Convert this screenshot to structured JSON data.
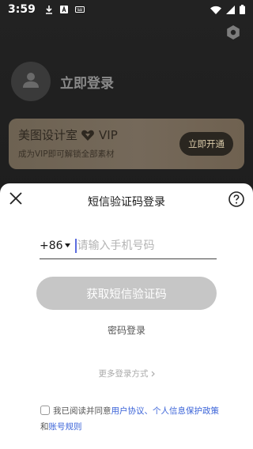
{
  "status_bar": {
    "time": "3:59",
    "left_icons": [
      "download-icon",
      "a-badge-icon",
      "keyboard-icon"
    ],
    "right_icons": [
      "wifi-icon",
      "signal-icon",
      "battery-icon"
    ]
  },
  "background": {
    "login_prompt": "立即登录",
    "vip": {
      "brand": "美图设计室",
      "badge": "VIP",
      "subtitle": "成为VIP即可解锁全部素材",
      "open_button": "立即开通"
    }
  },
  "sheet": {
    "title": "短信验证码登录",
    "country_code": "+86",
    "phone_placeholder": "请输入手机号码",
    "phone_value": "",
    "get_code_button": "获取短信验证码",
    "password_login": "密码登录",
    "more_login": "更多登录方式",
    "agreement": {
      "prefix": "我已阅读并同意",
      "user_agreement": "用户协议",
      "separator": "、",
      "privacy_policy": "个人信息保护政策",
      "and": "和",
      "account_rules": "账号规则",
      "checked": false
    }
  },
  "colors": {
    "accent_link": "#3a63d8",
    "button_disabled": "#c6c6c6",
    "vip_gold": "#75695a"
  }
}
